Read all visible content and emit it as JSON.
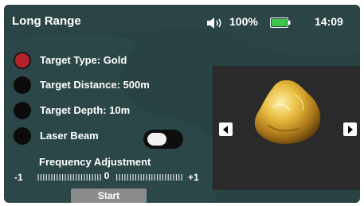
{
  "header": {
    "title": "Long Range",
    "volume_icon": "speaker-icon",
    "battery_percent": "100%",
    "battery_icon": "battery-full-icon",
    "battery_color": "#3dc84c",
    "time": "14:09"
  },
  "options": [
    {
      "label": "Target Type: Gold",
      "selected": true
    },
    {
      "label": "Target Distance: 500m",
      "selected": false
    },
    {
      "label": "Target Depth: 10m",
      "selected": false
    },
    {
      "label": "Laser Beam",
      "selected": false
    }
  ],
  "laser_toggle": {
    "on": false
  },
  "frequency": {
    "label": "Frequency Adjustment",
    "min_label": "-1",
    "max_label": "+1",
    "value": "0"
  },
  "start_button": {
    "label": "Start"
  },
  "viewer": {
    "image": "gold-nugget-image",
    "prev_icon": "chevron-left-icon",
    "next_icon": "chevron-right-icon"
  },
  "colors": {
    "background": "#2c4748",
    "selected_indicator": "#b2232b",
    "button": "#8a8c8c"
  }
}
